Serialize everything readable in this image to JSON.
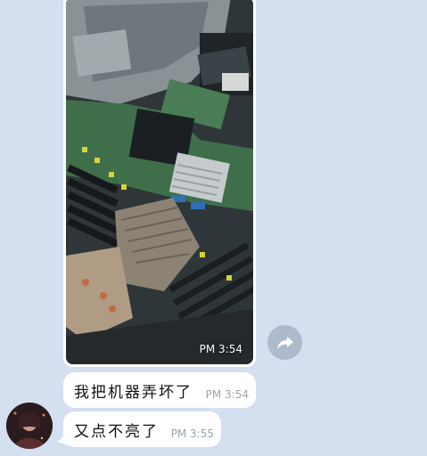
{
  "conversation": {
    "messages": [
      {
        "type": "image",
        "description_icon": "server-motherboard-photo",
        "time": "PM 3:54"
      },
      {
        "type": "text",
        "text": "我把机器弄坏了",
        "time": "PM 3:54"
      },
      {
        "type": "text",
        "text": "又点不亮了",
        "time": "PM 3:55"
      }
    ],
    "share_icon": "forward-arrow-icon",
    "avatar_icon": "user-avatar"
  },
  "colors": {
    "background": "#d4dfef",
    "bubble": "#ffffff",
    "share_button": "#aebacb",
    "time_text": "#9aa3ad"
  }
}
